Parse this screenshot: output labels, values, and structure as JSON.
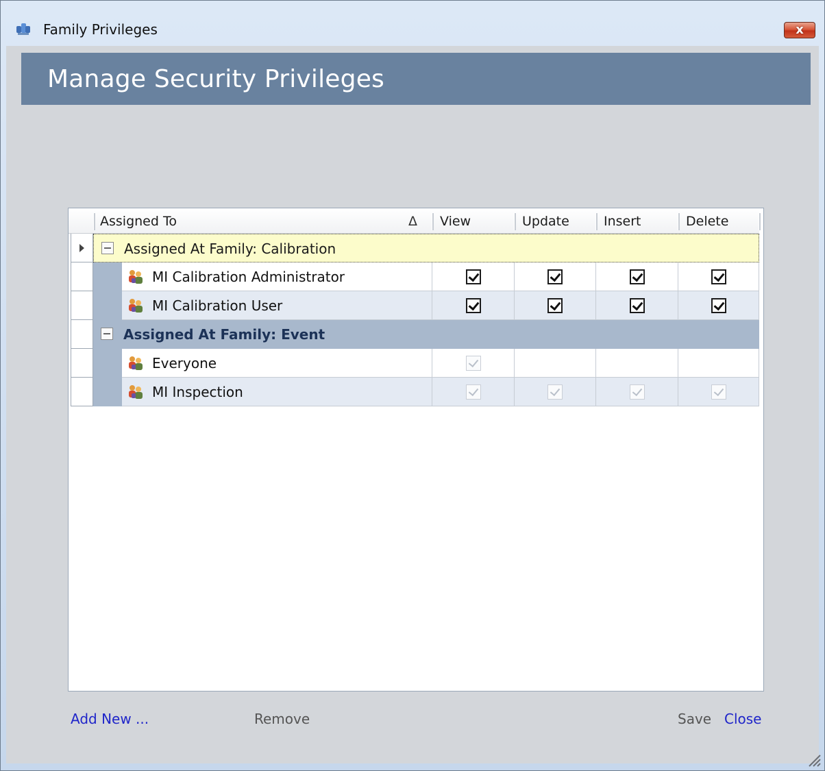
{
  "window": {
    "title": "Family Privileges",
    "icon": "family-privileges-icon",
    "close_glyph": "x"
  },
  "header": {
    "title": "Manage Security Privileges"
  },
  "grid": {
    "columns": {
      "assigned_to": "Assigned To",
      "sort_indicator": "Δ",
      "view": "View",
      "update": "Update",
      "insert": "Insert",
      "delete": "Delete"
    },
    "groups": [
      {
        "label": "Assigned At Family: Calibration",
        "highlighted": true,
        "rows": [
          {
            "name": "MI Calibration Administrator",
            "view": true,
            "update": true,
            "insert": true,
            "delete": true,
            "enabled": true
          },
          {
            "name": "MI Calibration User",
            "view": true,
            "update": true,
            "insert": true,
            "delete": true,
            "enabled": true
          }
        ]
      },
      {
        "label": "Assigned At Family: Event",
        "highlighted": false,
        "rows": [
          {
            "name": "Everyone",
            "view": true,
            "update": false,
            "insert": false,
            "delete": false,
            "enabled": false
          },
          {
            "name": "MI Inspection",
            "view": true,
            "update": true,
            "insert": true,
            "delete": true,
            "enabled": false
          }
        ]
      }
    ]
  },
  "footer": {
    "add_new": "Add New ...",
    "remove": "Remove",
    "save": "Save",
    "close": "Close"
  },
  "colors": {
    "header_band": "#69829f",
    "link": "#1f25c9",
    "group_highlight": "#fcfccb",
    "group_band": "#a8b8cc"
  }
}
